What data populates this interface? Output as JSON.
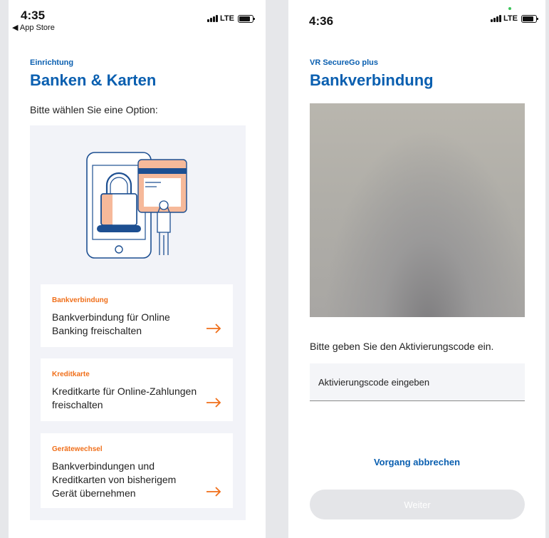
{
  "left_screen": {
    "status": {
      "time": "4:35",
      "back": "◀ App Store",
      "network": "LTE"
    },
    "subtitle": "Einrichtung",
    "title": "Banken & Karten",
    "prompt": "Bitte wählen Sie eine Option:",
    "options": [
      {
        "label": "Bankverbindung",
        "description": "Bankverbindung für Online Banking freischalten"
      },
      {
        "label": "Kreditkarte",
        "description": "Kreditkarte für Online-Zahlungen freischalten"
      },
      {
        "label": "Gerätewechsel",
        "description": "Bankverbindungen und Kreditkarten von bisherigem Gerät übernehmen"
      }
    ]
  },
  "right_screen": {
    "status": {
      "time": "4:36",
      "network": "LTE"
    },
    "subtitle": "VR SecureGo plus",
    "title": "Bankverbindung",
    "instruction": "Bitte geben Sie den Aktivierungscode ein.",
    "code_input": {
      "value": "",
      "placeholder": "Aktivierungscode eingeben"
    },
    "cancel_label": "Vorgang abbrechen",
    "continue_label": "Weiter"
  },
  "colors": {
    "brand_blue": "#0a5fb0",
    "accent_orange": "#f06f1a",
    "panel_background": "#f2f3f8",
    "outer_background": "#e6e7ea"
  },
  "icons": [
    "signal-bars-icon",
    "battery-icon",
    "padlock-phone-illustration",
    "arrow-right-icon"
  ]
}
